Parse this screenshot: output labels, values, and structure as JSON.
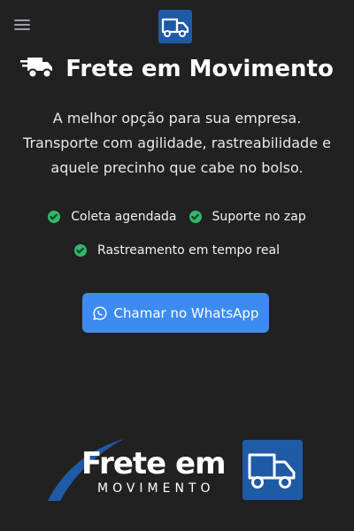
{
  "hero": {
    "title": "Frete em Movimento",
    "subtitle": "A melhor opção para sua empresa. Transporte com agilidade, rastreabilidade e aquele precinho que cabe no bolso."
  },
  "features": [
    "Coleta agendada",
    "Suporte no zap",
    "Rastreamento em tempo real"
  ],
  "cta": {
    "label": "Chamar no WhatsApp"
  },
  "footer_logo": {
    "line1": "Frete em",
    "line2": "MOVIMENTO"
  },
  "icons": {
    "menu": "hamburger-menu-icon",
    "brand": "truck-icon",
    "title": "shipping-fast-icon",
    "feature": "check-circle-icon",
    "cta": "whatsapp-icon"
  },
  "colors": {
    "background": "#212121",
    "accent": "#3d8bf0",
    "check": "#2fb86b",
    "logo_blue": "#1f5aa6"
  }
}
